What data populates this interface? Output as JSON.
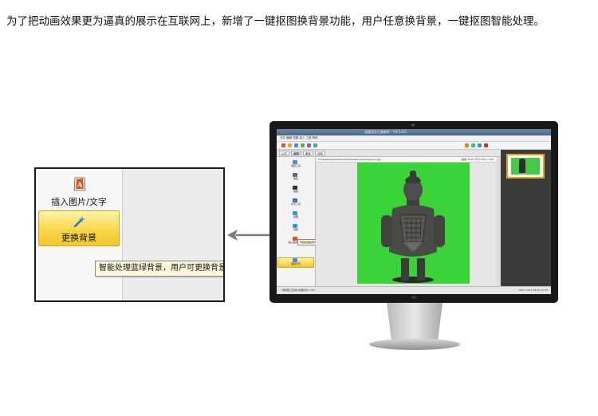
{
  "caption": "为了把动画效果更为逼真的展示在互联网上，新增了一键抠图换背景功能，用户任意换背景，一键抠图智能处理。",
  "zoom": {
    "insert_label": "插入图片/文字",
    "replace_bg_label": "更换背景",
    "tooltip": "智能处理蓝绿背景，用户可更换背景"
  },
  "app": {
    "window_title": "动画设计工具软件 - V4.5.0.0",
    "menu": "文件  编辑  视图  插入  工具  帮助",
    "tabs": [
      "公共",
      "编辑",
      "美化",
      "动作"
    ],
    "path": "D:\\Desktop\\animation\\work\\GreenScreen\\warrior.jpg",
    "zoom_info": "缩放 75.0%  尺寸 700 × 700",
    "side_items": [
      "选择工具",
      "裁剪",
      "画笔",
      "文字工具",
      "抠图",
      "特效",
      "插入图片/文字",
      "更换背景"
    ],
    "mini_tooltip": "智能处理蓝绿背景，用户可更换背景",
    "status_left": "一键抠图 已完成 处理时间 0.05s",
    "status_right": "100%  2017-06-22 10:45"
  },
  "colors": {
    "green_screen": "#3ad33a",
    "highlight": "#f8d74a",
    "arrow": "#7a7a7a"
  }
}
